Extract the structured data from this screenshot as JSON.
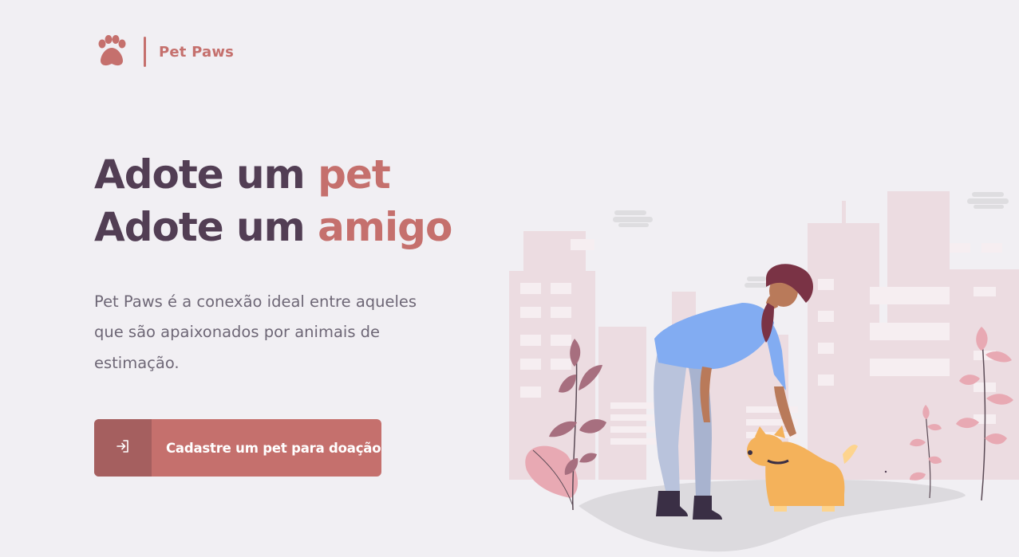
{
  "brand": {
    "name": "Pet Paws",
    "logo_icon": "paw-icon",
    "accent_color": "#c5706d",
    "dark_color": "#523e54"
  },
  "hero": {
    "line1_prefix": "Adote um ",
    "line1_accent": "pet",
    "line2_prefix": "Adote um ",
    "line2_accent": "amigo"
  },
  "description": "Pet Paws é a conexão ideal entre aqueles que são apaixonados por animais de estimação.",
  "cta": {
    "label": "Cadastre um pet para doação",
    "icon": "login-icon"
  },
  "illustration": {
    "icon": "woman-petting-dog-illustration"
  }
}
